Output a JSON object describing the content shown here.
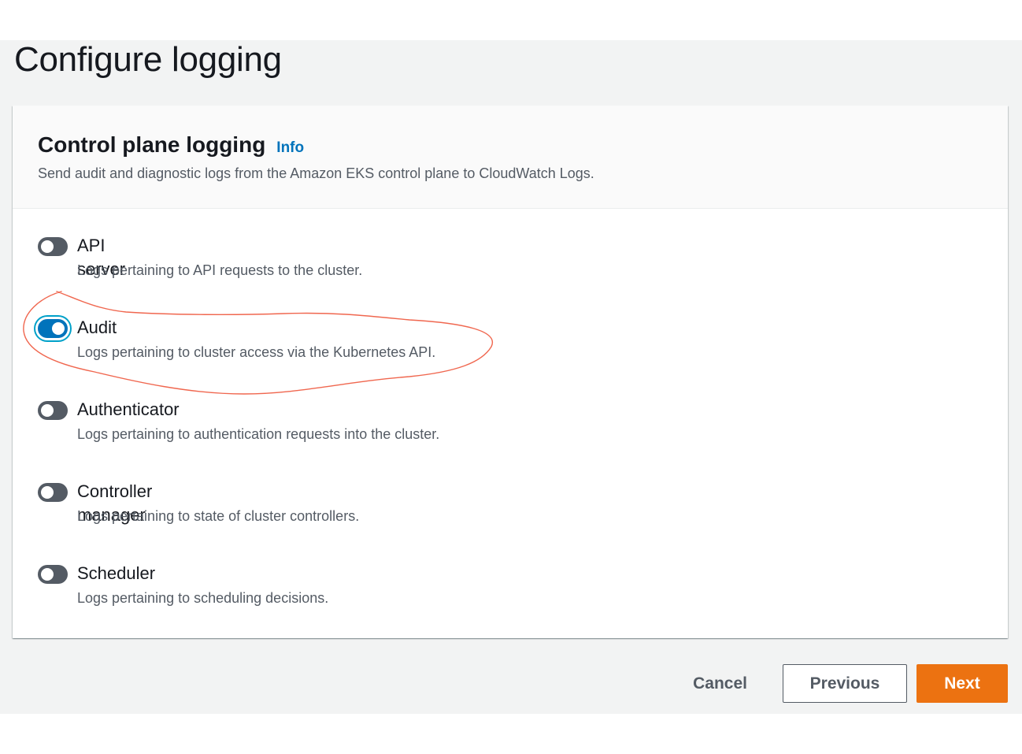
{
  "page": {
    "title": "Configure logging"
  },
  "panel": {
    "title": "Control plane logging",
    "info_label": "Info",
    "description": "Send audit and diagnostic logs from the Amazon EKS control plane to CloudWatch Logs."
  },
  "log_types": [
    {
      "label": "API server",
      "description": "Logs pertaining to API requests to the cluster.",
      "enabled": false
    },
    {
      "label": "Audit",
      "description": "Logs pertaining to cluster access via the Kubernetes API.",
      "enabled": true
    },
    {
      "label": "Authenticator",
      "description": "Logs pertaining to authentication requests into the cluster.",
      "enabled": false
    },
    {
      "label": "Controller manager",
      "description": "Logs pertaining to state of cluster controllers.",
      "enabled": false
    },
    {
      "label": "Scheduler",
      "description": "Logs pertaining to scheduling decisions.",
      "enabled": false
    }
  ],
  "actions": {
    "cancel_label": "Cancel",
    "previous_label": "Previous",
    "next_label": "Next"
  },
  "colors": {
    "accent": "#0073bb",
    "primary_button": "#ec7211",
    "annotation": "#f0674f"
  }
}
